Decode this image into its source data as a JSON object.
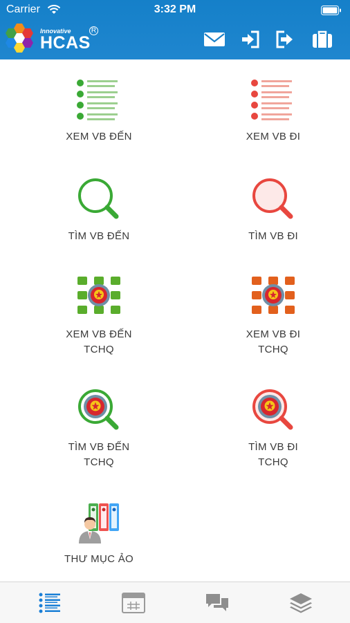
{
  "status_bar": {
    "carrier": "Carrier",
    "time": "3:32 PM"
  },
  "header": {
    "logo_small": "Innovative",
    "logo_name": "HCAS",
    "logo_registered": "R",
    "icons": [
      "mail-icon",
      "login-icon",
      "logout-icon",
      "briefcase-icon"
    ]
  },
  "menu": {
    "item1": {
      "line1": "XEM VB ĐẾN",
      "line2": "",
      "icon": "list-icon",
      "color": "#3aa935"
    },
    "item2": {
      "line1": "XEM VB ĐI",
      "line2": "",
      "icon": "list-icon",
      "color": "#e8473f"
    },
    "item3": {
      "line1": "TÌM VB ĐẾN",
      "line2": "",
      "icon": "search-icon",
      "color": "#3aa935"
    },
    "item4": {
      "line1": "TÌM VB ĐI",
      "line2": "",
      "icon": "search-icon",
      "color": "#e8473f"
    },
    "item5": {
      "line1": "XEM VB ĐẾN",
      "line2": "TCHQ",
      "icon": "emblem-grid-icon",
      "color": "#5aad2c"
    },
    "item6": {
      "line1": "XEM VB ĐI",
      "line2": "TCHQ",
      "icon": "emblem-grid-icon",
      "color": "#e2601d"
    },
    "item7": {
      "line1": "TÌM VB ĐẾN",
      "line2": "TCHQ",
      "icon": "emblem-search-icon",
      "color": "#3aa935"
    },
    "item8": {
      "line1": "TÌM VB ĐI",
      "line2": "TCHQ",
      "icon": "emblem-search-icon",
      "color": "#e8473f"
    },
    "item9": {
      "line1": "THƯ MỤC ẢO",
      "line2": "",
      "icon": "folders-user-icon",
      "color": "#3a7fd5"
    }
  },
  "tabbar": {
    "tabs": [
      "list-tab-icon",
      "calendar-tab-icon",
      "chat-tab-icon",
      "layers-tab-icon"
    ],
    "active_color": "#1a7fd6",
    "inactive_color": "#8e8e8e"
  }
}
